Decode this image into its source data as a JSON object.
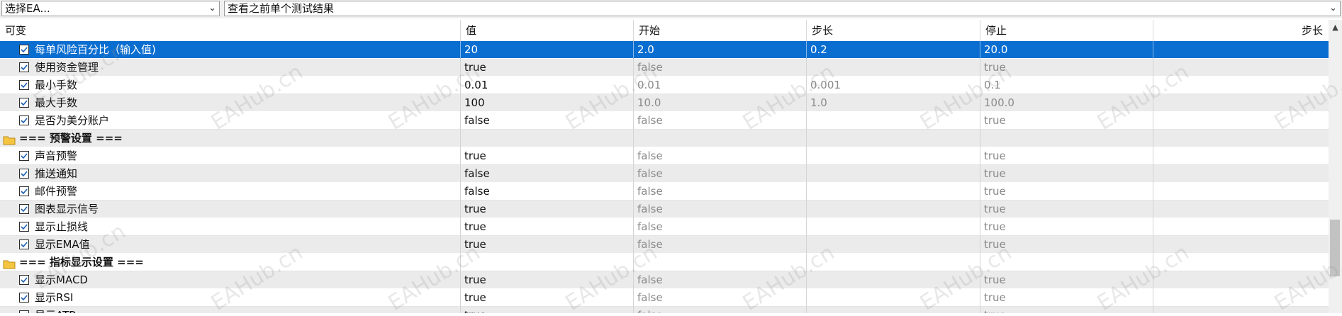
{
  "toolbar": {
    "ea_select": "选择EA...",
    "result_select": "查看之前单个测试结果"
  },
  "columns": [
    "可变",
    "值",
    "开始",
    "步长",
    "停止",
    "步长"
  ],
  "rows": [
    {
      "type": "param",
      "selected": true,
      "checked": true,
      "name": "每单风险百分比（输入值)",
      "value": "20",
      "start": "2.0",
      "step": "0.2",
      "stop": "20.0"
    },
    {
      "type": "param",
      "checked": true,
      "name": "使用资金管理",
      "value": "true",
      "start": "false",
      "step": "",
      "stop": "true"
    },
    {
      "type": "param",
      "checked": true,
      "name": "最小手数",
      "value": "0.01",
      "start": "0.01",
      "step": "0.001",
      "stop": "0.1"
    },
    {
      "type": "param",
      "checked": true,
      "name": "最大手数",
      "value": "100",
      "start": "10.0",
      "step": "1.0",
      "stop": "100.0"
    },
    {
      "type": "param",
      "checked": true,
      "name": "是否为美分账户",
      "value": "false",
      "start": "false",
      "step": "",
      "stop": "true"
    },
    {
      "type": "group",
      "name": "=== 预警设置 ==="
    },
    {
      "type": "param",
      "checked": true,
      "name": "声音预警",
      "value": "true",
      "start": "false",
      "step": "",
      "stop": "true"
    },
    {
      "type": "param",
      "checked": true,
      "name": "推送通知",
      "value": "false",
      "start": "false",
      "step": "",
      "stop": "true"
    },
    {
      "type": "param",
      "checked": true,
      "name": "邮件预警",
      "value": "false",
      "start": "false",
      "step": "",
      "stop": "true"
    },
    {
      "type": "param",
      "checked": true,
      "name": "图表显示信号",
      "value": "true",
      "start": "false",
      "step": "",
      "stop": "true"
    },
    {
      "type": "param",
      "checked": true,
      "name": "显示止损线",
      "value": "true",
      "start": "false",
      "step": "",
      "stop": "true"
    },
    {
      "type": "param",
      "checked": true,
      "name": "显示EMA值",
      "value": "true",
      "start": "false",
      "step": "",
      "stop": "true"
    },
    {
      "type": "group",
      "name": "=== 指标显示设置 ==="
    },
    {
      "type": "param",
      "checked": true,
      "name": "显示MACD",
      "value": "true",
      "start": "false",
      "step": "",
      "stop": "true"
    },
    {
      "type": "param",
      "checked": true,
      "name": "显示RSI",
      "value": "true",
      "start": "false",
      "step": "",
      "stop": "true"
    },
    {
      "type": "param",
      "checked": true,
      "name": "显示ATR",
      "value": "true",
      "start": "false",
      "step": "",
      "stop": "true"
    }
  ],
  "watermark": "EAHub.cn",
  "colors": {
    "selection": "#0a6ed1",
    "alt_row": "#ebebeb",
    "dim_text": "#8a8a8a",
    "folder": "#f5c542"
  }
}
